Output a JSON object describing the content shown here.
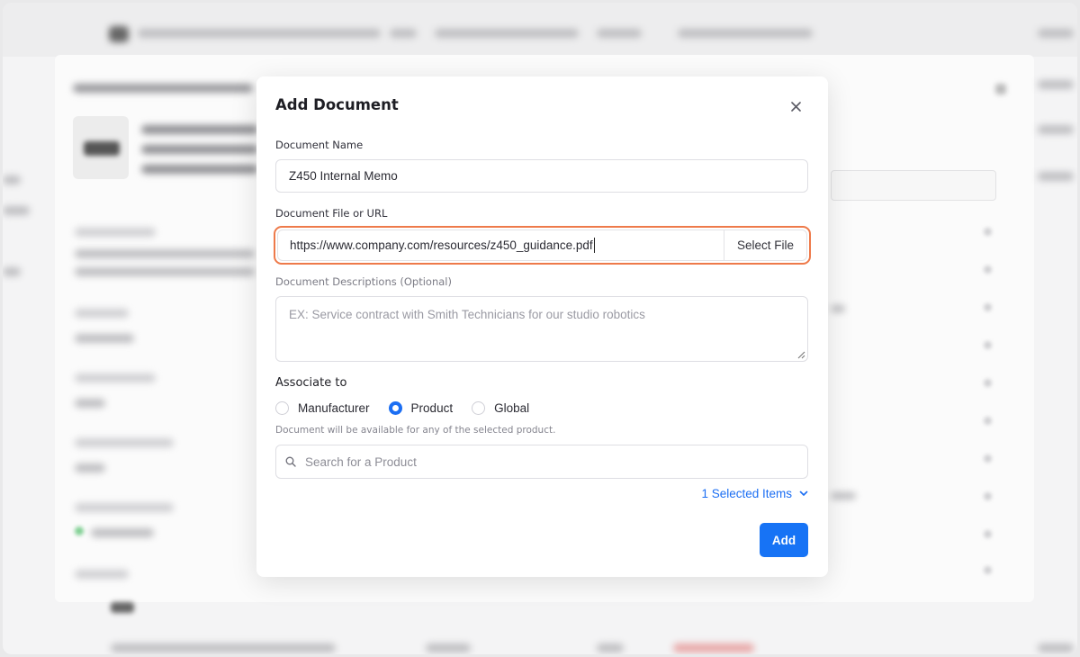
{
  "modal": {
    "title": "Add Document",
    "document_name": {
      "label": "Document Name",
      "value": "Z450 Internal Memo"
    },
    "document_file": {
      "label": "Document File or URL",
      "value": "https://www.company.com/resources/z450_guidance.pdf",
      "select_file_label": "Select File",
      "focus_color": "#ee7a4a"
    },
    "document_description": {
      "label": "Document Descriptions (Optional)",
      "placeholder": "EX: Service contract with Smith Technicians for our studio robotics"
    },
    "associate": {
      "title": "Associate to",
      "options": [
        {
          "label": "Manufacturer",
          "checked": false
        },
        {
          "label": "Product",
          "checked": true
        },
        {
          "label": "Global",
          "checked": false
        }
      ],
      "helper_text": "Document will be available for any of the selected product."
    },
    "search": {
      "placeholder": "Search for a Product",
      "icon": "search-icon"
    },
    "selected_items_label": "1 Selected Items",
    "add_button_label": "Add",
    "accent_color": "#1773f5"
  }
}
